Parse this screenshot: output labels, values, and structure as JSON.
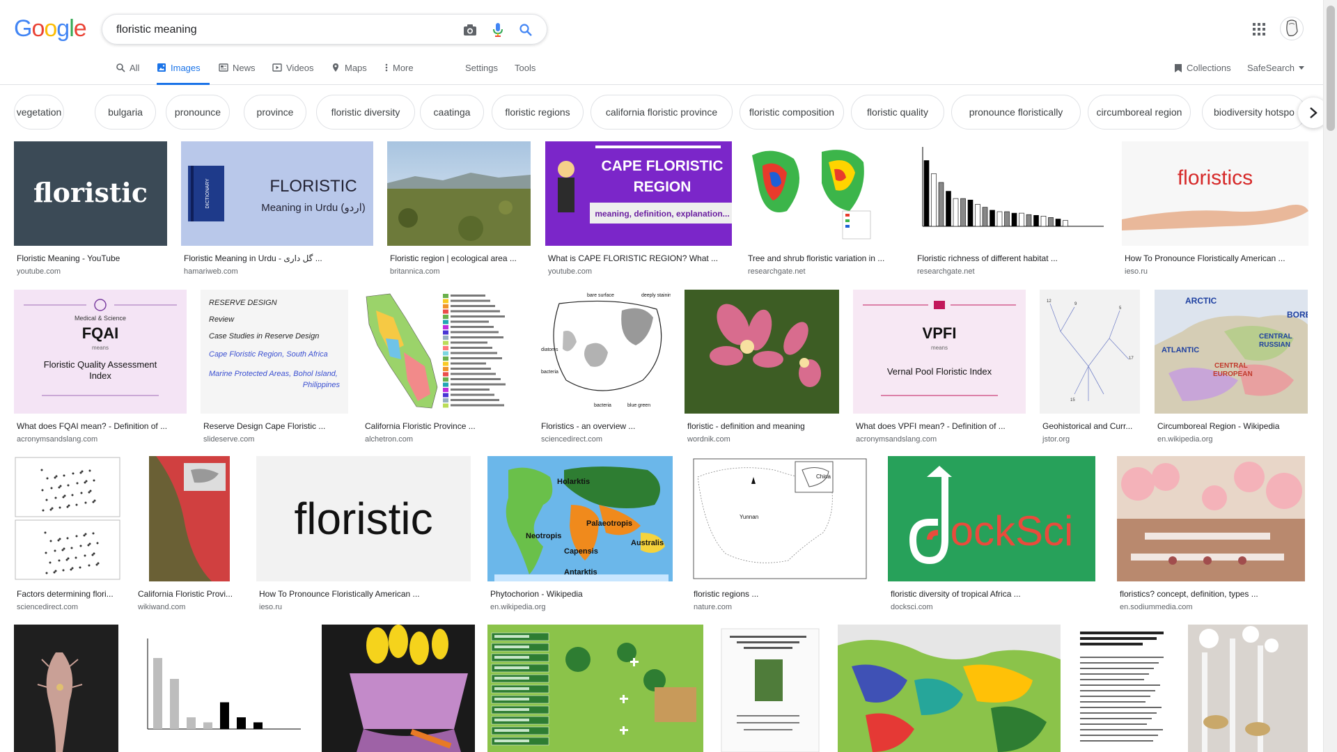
{
  "logo": {
    "letters": [
      "G",
      "o",
      "o",
      "g",
      "l",
      "e"
    ],
    "colors": [
      "#4285f4",
      "#ea4335",
      "#fbbc05",
      "#4285f4",
      "#34a853",
      "#ea4335"
    ]
  },
  "search": {
    "query": "floristic meaning"
  },
  "tabs": [
    {
      "label": "All",
      "icon": "search-icon"
    },
    {
      "label": "Images",
      "icon": "image-icon"
    },
    {
      "label": "News",
      "icon": "news-icon"
    },
    {
      "label": "Videos",
      "icon": "video-icon"
    },
    {
      "label": "Maps",
      "icon": "map-pin-icon"
    },
    {
      "label": "More",
      "icon": "more-vert-icon"
    }
  ],
  "tools": {
    "settings": "Settings",
    "tools": "Tools",
    "collections": "Collections",
    "safesearch": "SafeSearch"
  },
  "chips": [
    "vegetation",
    "bulgaria",
    "pronounce",
    "province",
    "floristic diversity",
    "caatinga",
    "floristic regions",
    "california floristic province",
    "floristic composition",
    "floristic quality",
    "pronounce floristically",
    "circumboreal region",
    "biodiversity hotspo"
  ],
  "results": [
    {
      "title": "Floristic Meaning - YouTube",
      "source": "youtube.com",
      "overlay": "floristic"
    },
    {
      "title": "Floristic Meaning in Urdu - گل داری ...",
      "source": "hamariweb.com",
      "overlay": "FLORISTIC",
      "overlay2": "Meaning in Urdu (اردو)",
      "overlay3": "DICTIONARY"
    },
    {
      "title": "Floristic region | ecological area ...",
      "source": "britannica.com"
    },
    {
      "title": "What is CAPE FLORISTIC REGION? What ...",
      "source": "youtube.com",
      "overlay": "CAPE FLORISTIC",
      "overlay2": "REGION",
      "overlay3": "meaning, definition, explanation..."
    },
    {
      "title": "Tree and shrub floristic variation in ...",
      "source": "researchgate.net"
    },
    {
      "title": "Floristic richness of different habitat ...",
      "source": "researchgate.net"
    },
    {
      "title": "How To Pronounce Floristically American ...",
      "source": "ieso.ru",
      "overlay": "floristics"
    },
    {
      "title": "What does FQAI mean? - Definition of ...",
      "source": "acronymsandslang.com",
      "overlay": "FQAI",
      "overlay2": "Floristic Quality Assessment Index",
      "overlay3": "Medical & Science",
      "overlay4": "means"
    },
    {
      "title": "Reserve Design Cape Floristic ...",
      "source": "slideserve.com",
      "overlay": "RESERVE DESIGN",
      "overlay2": "Review",
      "overlay3": "Case Studies in Reserve Design",
      "overlay4": "Cape Floristic Region, South Africa",
      "overlay5": "Marine Protected Areas, Bohol Island, Philippines"
    },
    {
      "title": "California Floristic Province ...",
      "source": "alchetron.com"
    },
    {
      "title": "Floristics - an overview ...",
      "source": "sciencedirect.com"
    },
    {
      "title": "floristic - definition and meaning",
      "source": "wordnik.com"
    },
    {
      "title": "What does VPFI mean? - Definition of ...",
      "source": "acronymsandslang.com",
      "overlay": "VPFI",
      "overlay2": "Vernal Pool Floristic Index",
      "overlay4": "means"
    },
    {
      "title": "Geohistorical and Curr...",
      "source": "jstor.org"
    },
    {
      "title": "Circumboreal Region - Wikipedia",
      "source": "en.wikipedia.org",
      "overlay": "ARCTIC",
      "overlay2": "BOREAL",
      "overlay3": "ATLANTIC",
      "overlay4": "CENTRAL RUSSIAN",
      "overlay5": "CENTRAL EUROPEAN"
    },
    {
      "title": "Factors determining flori...",
      "source": "sciencedirect.com"
    },
    {
      "title": "California Floristic Provi...",
      "source": "wikiwand.com"
    },
    {
      "title": "How To Pronounce Floristically American ...",
      "source": "ieso.ru",
      "overlay": "floristic"
    },
    {
      "title": "Phytochorion - Wikipedia",
      "source": "en.wikipedia.org",
      "overlay": "Holarktis",
      "overlay2": "Neotropis",
      "overlay3": "Palaeotropis",
      "overlay4": "Capensis",
      "overlay5": "Australis",
      "overlay6": "Antarktis"
    },
    {
      "title": "floristic regions ...",
      "source": "nature.com",
      "overlay": "Yunnan",
      "overlay2": "China"
    },
    {
      "title": "floristic diversity of tropical Africa ...",
      "source": "docksci.com",
      "overlay": "dockSci"
    },
    {
      "title": "floristics? concept, definition, types ...",
      "source": "en.sodiummedia.com"
    },
    {
      "title": "",
      "source": ""
    },
    {
      "title": "",
      "source": ""
    },
    {
      "title": "",
      "source": ""
    },
    {
      "title": "",
      "source": ""
    },
    {
      "title": "",
      "source": ""
    },
    {
      "title": "",
      "source": ""
    },
    {
      "title": "",
      "source": ""
    },
    {
      "title": "",
      "source": ""
    }
  ]
}
